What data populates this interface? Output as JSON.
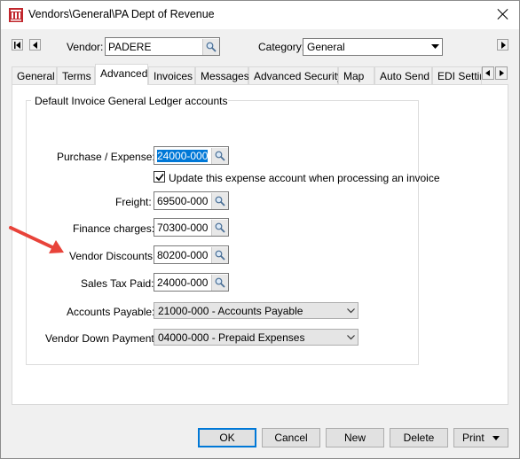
{
  "window": {
    "title": "Vendors\\General\\PA Dept of Revenue"
  },
  "header": {
    "vendor_label": "Vendor:",
    "vendor_value": "PADERE",
    "category_label": "Category:",
    "category_value": "General"
  },
  "tabs": [
    {
      "label": "General"
    },
    {
      "label": "Terms"
    },
    {
      "label": "Advanced"
    },
    {
      "label": "Invoices"
    },
    {
      "label": "Messages"
    },
    {
      "label": "Advanced Security"
    },
    {
      "label": "Map"
    },
    {
      "label": "Auto Send"
    },
    {
      "label": "EDI Setting"
    }
  ],
  "group": {
    "title": "Default Invoice General Ledger accounts",
    "purchase_label": "Purchase / Expense:",
    "purchase_value": "24000-000",
    "update_checkbox_label": "Update this expense account when processing an invoice",
    "update_checked": true,
    "freight_label": "Freight:",
    "freight_value": "69500-000",
    "finance_label": "Finance charges:",
    "finance_value": "70300-000",
    "discounts_label": "Vendor Discounts:",
    "discounts_value": "80200-000",
    "salestax_label": "Sales Tax Paid:",
    "salestax_value": "24000-000",
    "payable_label": "Accounts Payable:",
    "payable_value": "21000-000 - Accounts Payable",
    "downpayment_label": "Vendor Down Payment:",
    "downpayment_value": "04000-000 - Prepaid Expenses"
  },
  "buttons": {
    "ok": "OK",
    "cancel": "Cancel",
    "new": "New",
    "delete": "Delete",
    "print": "Print"
  },
  "colors": {
    "annotation_arrow": "#e8433a",
    "selection": "#0078d7"
  }
}
